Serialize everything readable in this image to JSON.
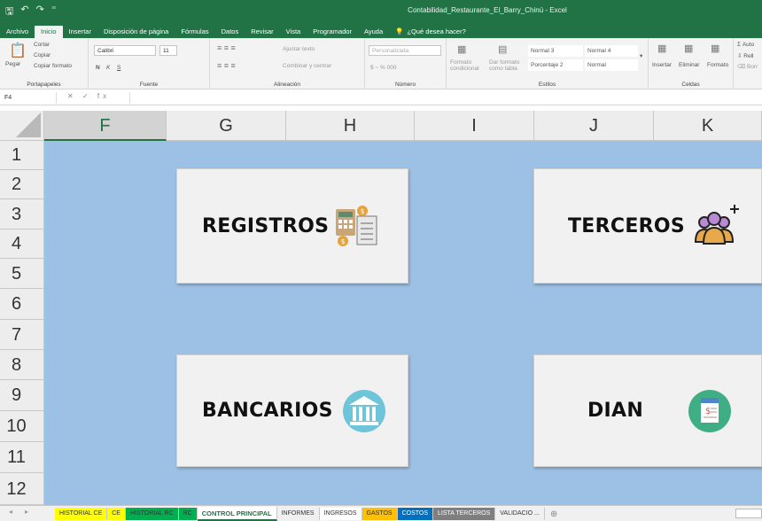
{
  "window": {
    "title": "Contabilidad_Restaurante_El_Barry_Chinú  -  Excel",
    "qat": [
      "🖫",
      "↶",
      "↷",
      "⁼"
    ]
  },
  "ribbon_tabs": [
    {
      "label": "Archivo"
    },
    {
      "label": "Inicio"
    },
    {
      "label": "Insertar"
    },
    {
      "label": "Disposición de página"
    },
    {
      "label": "Fórmulas"
    },
    {
      "label": "Datos"
    },
    {
      "label": "Revisar"
    },
    {
      "label": "Vista"
    },
    {
      "label": "Programador"
    },
    {
      "label": "Ayuda"
    }
  ],
  "tell_me": "¿Qué desea hacer?",
  "ribbon": {
    "portapapeles": {
      "label": "Portapapeles",
      "paste": "Pegar",
      "cut": "Cortar",
      "copy": "Copiar",
      "format": "Copiar formato"
    },
    "fuente": {
      "label": "Fuente",
      "font": "Calibri",
      "size": "11",
      "bold": "N",
      "italic": "K",
      "underline": "S"
    },
    "alineacion": {
      "label": "Alineación",
      "wrap": "Ajustar texto",
      "merge": "Combinar y centrar"
    },
    "numero": {
      "label": "Número",
      "format": "Personalizada",
      "currency": "$ ~ % 000"
    },
    "estilos": {
      "label": "Estilos",
      "cond": "Formato condicional",
      "table": "Dar formato como tabla",
      "cells": [
        "Normal 3",
        "Normal 4",
        "Porcentaje 2",
        "Normal"
      ]
    },
    "celdas": {
      "label": "Celdas",
      "insert": "Insertar",
      "delete": "Eliminar",
      "format": "Formato"
    },
    "edit": {
      "sum": "Auto",
      "fill": "Rell",
      "clear": "Borr"
    }
  },
  "formula_bar": {
    "name_box": "F4",
    "icons": "✕ ✓ fx",
    "value": ""
  },
  "columns": [
    "F",
    "G",
    "H",
    "I",
    "J",
    "K"
  ],
  "rows": [
    "1",
    "2",
    "3",
    "4",
    "5",
    "6",
    "7",
    "8",
    "9",
    "10",
    "11",
    "12"
  ],
  "buttons": {
    "registros": "REGISTROS",
    "terceros": "TERCEROS",
    "bancarios": "BANCARIOS",
    "dian": "DIAN"
  },
  "sheet_tabs": [
    {
      "label": "HISTORIAL CE",
      "color": "#ffff00"
    },
    {
      "label": "CE",
      "color": "#ffff00"
    },
    {
      "label": "HISTORIAL RC",
      "color": "#00b050"
    },
    {
      "label": "RC",
      "color": "#00b050"
    },
    {
      "label": "CONTROL PRINCIPAL",
      "color": "#ffffff"
    },
    {
      "label": "INFORMES",
      "color": "#f0f0f0"
    },
    {
      "label": "INGRESOS",
      "color": "#ffffff"
    },
    {
      "label": "GASTOS",
      "color": "#ffc000"
    },
    {
      "label": "COSTOS",
      "color": "#0070c0"
    },
    {
      "label": "LISTA TERCEROS",
      "color": "#7f7f7f"
    },
    {
      "label": "VALIDACIO ...",
      "color": "#f0f0f0"
    }
  ],
  "colors": {
    "excel_green": "#217346",
    "sheet_bg": "#9dc1e4"
  }
}
